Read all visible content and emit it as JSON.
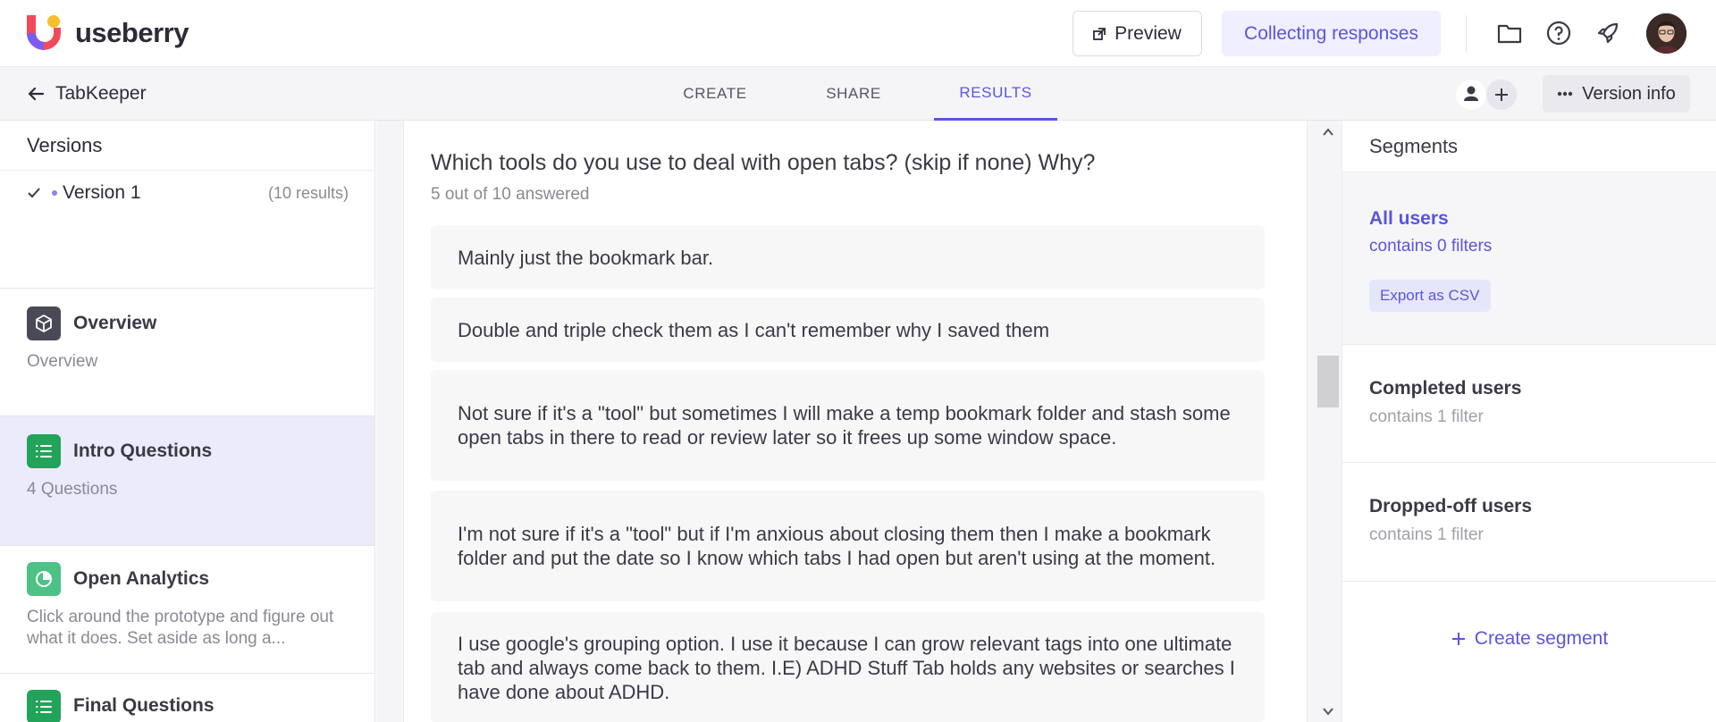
{
  "header": {
    "brand": "useberry",
    "preview_label": "Preview",
    "status_label": "Collecting responses",
    "colors": {
      "accent": "#5b54e0",
      "accent_bg": "#efefff"
    }
  },
  "subnav": {
    "back_label": "TabKeeper",
    "tabs": [
      {
        "label": "CREATE",
        "active": false
      },
      {
        "label": "SHARE",
        "active": false
      },
      {
        "label": "RESULTS",
        "active": true
      }
    ],
    "version_info_label": "Version info"
  },
  "sidebar": {
    "versions_title": "Versions",
    "versions": [
      {
        "name": "Version 1",
        "results": "(10 results)",
        "selected": true
      }
    ],
    "sections": [
      {
        "title": "Overview",
        "subtitle": "Overview",
        "icon": "cube-icon",
        "color": "#4a4a57",
        "active": false
      },
      {
        "title": "Intro Questions",
        "subtitle": "4 Questions",
        "icon": "list-icon",
        "color": "#22a35a",
        "active": true
      },
      {
        "title": "Open Analytics",
        "subtitle": "Click around the prototype and figure out what it does. Set aside as long a...",
        "icon": "pie-icon",
        "color": "#4cc287",
        "active": false
      },
      {
        "title": "Final Questions",
        "subtitle": "",
        "icon": "list-icon",
        "color": "#22a35a",
        "active": false
      }
    ]
  },
  "main": {
    "question": "Which tools do you use to deal with open tabs? (skip if none) Why?",
    "answered": "5 out of 10 answered",
    "answers": [
      "Mainly just the bookmark bar.",
      "Double and triple check them as I can't remember why I saved them",
      "Not sure if it's a \"tool\" but sometimes I will make a temp bookmark folder and stash some open tabs in there to read or review later so it frees up some window space.",
      "I'm not sure if it's a \"tool\" but if I'm anxious about closing them then I make a bookmark folder and put the date so I know which tabs I had open but aren't using at the moment.",
      "I use google's grouping option. I use it because I can grow relevant tags into one ultimate tab and always come back to them. I.E) ADHD Stuff Tab holds any websites or searches I have done about ADHD."
    ]
  },
  "segments": {
    "title": "Segments",
    "items": [
      {
        "name": "All users",
        "desc": "contains 0 filters",
        "active": true
      },
      {
        "name": "Completed users",
        "desc": "contains 1 filter",
        "active": false
      },
      {
        "name": "Dropped-off users",
        "desc": "contains 1 filter",
        "active": false
      }
    ],
    "export_label": "Export as CSV",
    "create_label": "Create segment"
  }
}
